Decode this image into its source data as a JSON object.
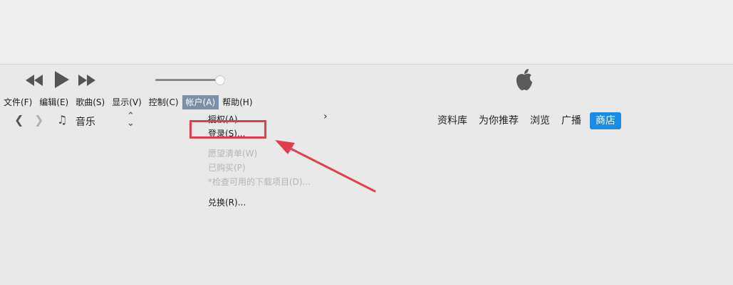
{
  "menubar": {
    "items": [
      "文件(F)",
      "编辑(E)",
      "歌曲(S)",
      "显示(V)",
      "控制(C)",
      "帐户(A)",
      "帮助(H)"
    ],
    "active_index": 5
  },
  "nav": {
    "library_label": "音乐",
    "tabs": [
      "资料库",
      "为你推荐",
      "浏览",
      "广播",
      "商店"
    ],
    "selected_tab": "商店"
  },
  "account_menu": {
    "authorize": "授权(A)",
    "sign_in": "登录(S)...",
    "wishlist": "愿望清单(W)",
    "purchased": "已购买(P)",
    "check_downloads": "*检查可用的下载项目(D)...",
    "redeem": "兑换(R)..."
  },
  "colors": {
    "accent": "#1a8ce6",
    "highlight_box": "#e0404e",
    "menu_active": "#7d8fa6"
  },
  "icons": [
    "rewind-icon",
    "play-icon",
    "fast-forward-icon",
    "apple-logo-icon",
    "music-note-icon",
    "chevron-left-icon",
    "chevron-right-icon",
    "updown-icon"
  ]
}
